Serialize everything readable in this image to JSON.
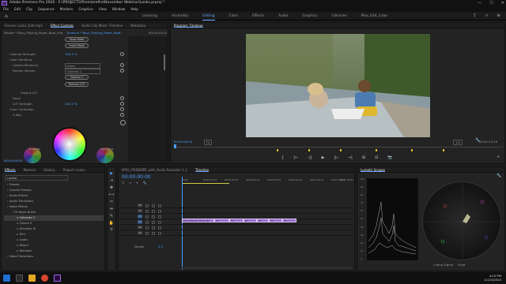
{
  "window": {
    "title": "Adobe Premiere Pro 2020 - E:\\PROJECTS\\PremierePro\\November Webinar\\Looks.prproj *",
    "app_icon": "Pr",
    "controls": [
      "—",
      "☐",
      "✕"
    ]
  },
  "menu": [
    "File",
    "Edit",
    "Clip",
    "Sequence",
    "Markers",
    "Graphics",
    "View",
    "Window",
    "Help"
  ],
  "workspaces": {
    "items": [
      "Learning",
      "Assembly",
      "Editing",
      "Color",
      "Effects",
      "Audio",
      "Graphics",
      "Libraries",
      "Max_Edit_Color"
    ],
    "active": "Editing"
  },
  "effect_controls": {
    "tabs": [
      "Source: Looks_Edit.mp4",
      "Effect Controls",
      "Audio Clip Mixer: Timeline",
      "Metadata"
    ],
    "active_tab": "Effect Controls",
    "master_label": "Master * Boys_Playing_Paper_Boat_Pull...",
    "clip_label": "Timeline * Boys_Playing_Paper_Boat...",
    "start_time": "00:00:14:22",
    "show_mask": "Show Mask",
    "invert_mask": "Invert Mask",
    "colorize_strength_label": "Colorize Strength",
    "colorize_strength_value": "100.0 %",
    "color_handling": "Color Handling",
    "control_recovery_label": "Control Recovery",
    "control_recovery_value": "Video",
    "render_version_label": "Render Version",
    "render_version_value": "Colorize 2",
    "colorize_btn": "Colorize 2",
    "remove_lut_btn": "Remove LUT",
    "output_lut": "Output LUT",
    "none_label": "None",
    "lut_strength_label": "LUT Strength",
    "lut_strength_value": "100.0 %",
    "color_correction": "Color Correction",
    "three_way": "3-Way",
    "shadow_label": "Shadow",
    "highlight_label": "Highlight",
    "timecode": "00:00:00:00"
  },
  "program_monitor": {
    "title": "Program: Timeline",
    "timecode": "00:00:00:00",
    "fit": "Fit",
    "quality": "1/2",
    "duration": "00:01:23:19",
    "transport": [
      "{",
      "|←",
      "◁|",
      "▶",
      "|▷",
      "→|",
      "⊞",
      "⊟",
      "📷"
    ]
  },
  "project_panel": {
    "tabs": [
      "Effects",
      "Markers",
      "History",
      "Project: Looks"
    ],
    "active_tab": "Effects",
    "search_value": "Lookie",
    "tree": [
      {
        "label": "Presets",
        "indent": 0
      },
      {
        "label": "Lumetri Presets",
        "indent": 0
      },
      {
        "label": "Audio Effects",
        "indent": 0
      },
      {
        "label": "Audio Transitions",
        "indent": 0
      },
      {
        "label": "Video Effects",
        "indent": 0
      },
      {
        "label": "FE Magic Bullet",
        "indent": 1
      },
      {
        "label": "Colorista V",
        "indent": 2,
        "selected": true
      },
      {
        "label": "Cosmo II",
        "indent": 2
      },
      {
        "label": "Denoiser III",
        "indent": 2
      },
      {
        "label": "Film",
        "indent": 2
      },
      {
        "label": "Looks",
        "indent": 2
      },
      {
        "label": "Mojo II",
        "indent": 2
      },
      {
        "label": "Renoiser",
        "indent": 2
      },
      {
        "label": "Video Transitions",
        "indent": 0
      }
    ]
  },
  "tools": [
    "▶",
    "⇥",
    "✥",
    "⟷",
    "✂",
    "⇹",
    "✎",
    "✋",
    "T"
  ],
  "timeline": {
    "tabs": [
      "WYO_FRIDEMPE_with_Audio Recorder 1_1",
      "Timeline"
    ],
    "active_tab": "Timeline",
    "timecode": "00:00:00:00",
    "ruler": [
      "00:00",
      "00:00:14:23",
      "00:00:29:23",
      "00:00:44:22",
      "00:00:59:22",
      "00:01:14:21",
      "00:01:29:21",
      "00:01:44:21",
      "00:01:59:21"
    ],
    "video_tracks": [
      "V3",
      "V2",
      "V1"
    ],
    "audio_tracks": [
      "A1",
      "A2",
      "A3"
    ],
    "master_label": "Master",
    "master_value": "0.0",
    "clips": [
      {
        "label": "Boys_Playing_Paper_Bo",
        "start": 0.0,
        "end": 0.19
      },
      {
        "label": "Fx",
        "start": 0.19,
        "end": 0.28
      },
      {
        "label": "Fx",
        "start": 0.28,
        "end": 0.36
      },
      {
        "label": "Fx",
        "start": 0.36,
        "end": 0.44
      },
      {
        "label": "Fx",
        "start": 0.44,
        "end": 0.51
      },
      {
        "label": "Fx Lumetri",
        "start": 0.51,
        "end": 0.59
      },
      {
        "label": "Fx WorldPa",
        "start": 0.59,
        "end": 0.67
      }
    ]
  },
  "scopes": {
    "title": "Lumetri Scopes",
    "clamp_signal": "Clamp Signal",
    "float_label": "Float",
    "levels": [
      "100",
      "90",
      "80",
      "70",
      "60",
      "50",
      "40",
      "30",
      "20",
      "10",
      "0"
    ]
  },
  "taskbar": {
    "time": "4:15 PM",
    "date": "11/24/2020"
  },
  "colors": {
    "accent": "#4aa0ff",
    "clip": "#9a6fd0",
    "panel": "#232323"
  }
}
